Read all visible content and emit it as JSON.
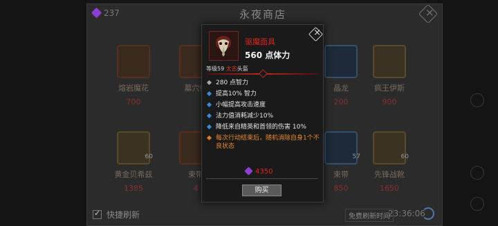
{
  "shop": {
    "title": "永夜商店",
    "currency_amount": "237",
    "slots": [
      {
        "name": "熔岩魔花",
        "price": "700",
        "qty": ""
      },
      {
        "name": "墓穴蝠",
        "price": "",
        "qty": ""
      },
      {
        "name": "晶龙",
        "price": "200",
        "qty": ""
      },
      {
        "name": "疯王伊斯",
        "price": "900",
        "qty": ""
      },
      {
        "name": "黄金贝希兹",
        "price": "1385",
        "qty": "60"
      },
      {
        "name": "束带",
        "price": "4",
        "qty": ""
      },
      {
        "name": "束带",
        "price": "850",
        "qty": "57"
      },
      {
        "name": "先锋战靴",
        "price": "1650",
        "qty": "60"
      }
    ],
    "quick_refresh_label": "快捷刷新",
    "free_refresh_label": "免费刷新时间",
    "refresh_timer": "23:36:06"
  },
  "tooltip": {
    "item_name": "驱魔面具",
    "main_stat": "560 点体力",
    "level_prefix": "等级59",
    "rarity": "太古",
    "slot_type": "头盔",
    "lines": [
      {
        "text": "280 点智力",
        "style": "gray"
      },
      {
        "text": "提高10% 智力",
        "style": "blue"
      },
      {
        "text": "小幅提高攻击速度",
        "style": "blue"
      },
      {
        "text": "法力值消耗减少10%",
        "style": "blue"
      },
      {
        "text": "降低来自精英和首领的伤害 10%",
        "style": "blue"
      },
      {
        "text": "每次行动结束后，随机消除自身1个不良状态",
        "style": "orange"
      }
    ],
    "price": "4350",
    "buy_label": "购买"
  },
  "colors": {
    "item_name": "#e0241c",
    "rarity": "#d93a1a",
    "affix_bullet": "#3a8ce0",
    "legendary_text": "#e88a2a",
    "gem": "#8a3fd0"
  }
}
